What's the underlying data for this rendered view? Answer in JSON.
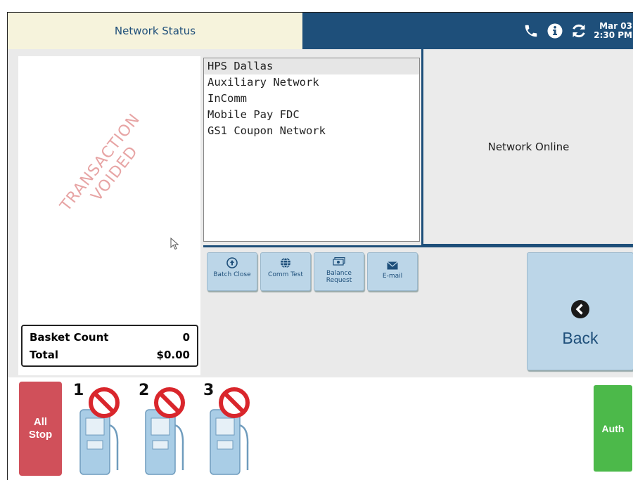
{
  "header": {
    "title": "Network Status",
    "date": "Mar 03",
    "time": "2:30 PM",
    "icons": [
      "phone-icon",
      "info-icon",
      "refresh-icon"
    ]
  },
  "receipt": {
    "watermark_line1": "TRANSACTION",
    "watermark_line2": "VOIDED",
    "basket_count_label": "Basket Count",
    "basket_count_value": "0",
    "total_label": "Total",
    "total_value": "$0.00"
  },
  "networks": {
    "items": [
      "HPS Dallas",
      "Auxiliary Network",
      "InComm",
      "Mobile Pay FDC",
      "GS1 Coupon Network"
    ],
    "selected": "HPS Dallas"
  },
  "status": {
    "text": "Network Online"
  },
  "actions": {
    "batch_close": "Batch Close",
    "comm_test": "Comm Test",
    "balance_request": "Balance Request",
    "email": "E-mail",
    "back": "Back"
  },
  "bottom": {
    "all_stop": "All Stop",
    "pumps": [
      "1",
      "2",
      "3"
    ],
    "auth": "Auth"
  },
  "colors": {
    "header_blue": "#1e4f7a",
    "header_cream": "#f6f3dc",
    "button_blue": "#bcd6e8",
    "all_stop_red": "#d0505a",
    "auth_green": "#4cb94a",
    "watermark_pink": "#e7a4a4"
  }
}
